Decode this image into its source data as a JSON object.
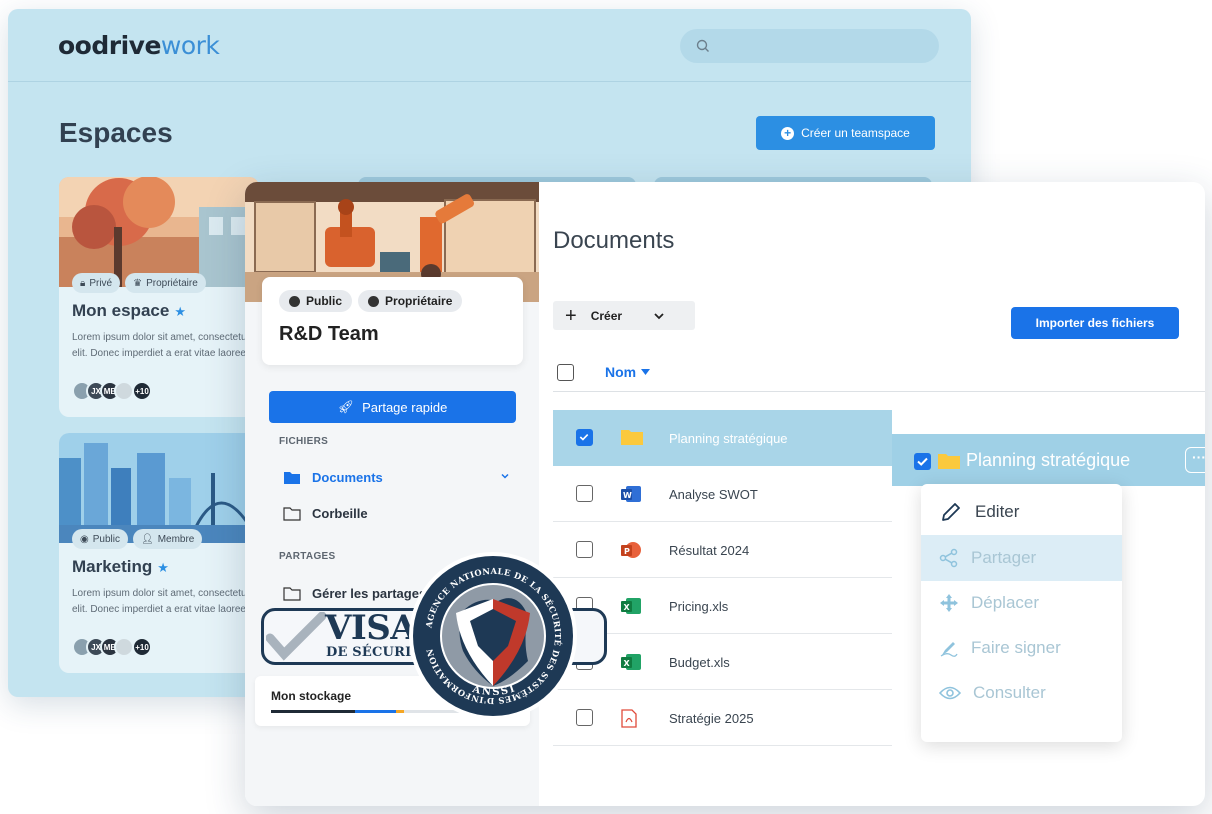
{
  "app": {
    "logo_part1": "oodrive",
    "logo_part2": "work"
  },
  "spaces_page": {
    "title": "Espaces",
    "create_button": "Créer un teamspace",
    "cards": [
      {
        "tags": [
          "Privé",
          "Propriétaire"
        ],
        "name": "Mon espace",
        "desc_line1": "Lorem ipsum dolor sit amet, consectetur",
        "desc_line2": "elit. Donec imperdiet  a erat vitae laoreet",
        "avatars": [
          "",
          "JX",
          "MB",
          "",
          "+10"
        ]
      },
      {
        "tags": [
          "Public",
          "Membre"
        ],
        "name": "Marketing",
        "desc_line1": "Lorem ipsum dolor sit amet, consectetur",
        "desc_line2": "elit. Donec imperdiet  a erat vitae laoreet",
        "avatars": [
          "",
          "JX",
          "MB",
          "",
          "+10"
        ]
      }
    ]
  },
  "team": {
    "tags": [
      "Public",
      "Propriétaire"
    ],
    "name": "R&D Team",
    "quick_share": "Partage rapide",
    "sections": {
      "files": "FICHIERS",
      "shares": "PARTAGES"
    },
    "items": {
      "documents": "Documents",
      "trash": "Corbeille",
      "manage_shares": "Gérer les partages"
    },
    "storage_label": "Mon stockage",
    "storage_segments": [
      {
        "fraction": 0.44,
        "color": "#1f2a36"
      },
      {
        "fraction": 0.22,
        "color": "#1a73e8"
      },
      {
        "fraction": 0.04,
        "color": "#f5a623"
      }
    ]
  },
  "documents": {
    "title": "Documents",
    "create": "Créer",
    "import": "Importer des fichiers",
    "column_name": "Nom",
    "files": [
      {
        "name": "Planning stratégique",
        "type": "folder",
        "selected": true
      },
      {
        "name": "Analyse SWOT",
        "type": "word",
        "selected": false
      },
      {
        "name": "Résultat 2024",
        "type": "powerpoint",
        "selected": false
      },
      {
        "name": "Pricing.xls",
        "type": "excel",
        "selected": false
      },
      {
        "name": "Budget.xls",
        "type": "excel",
        "selected": false
      },
      {
        "name": "Stratégie 2025",
        "type": "pdf",
        "selected": false
      }
    ],
    "dragged_name": "Planning stratégique"
  },
  "context_menu": {
    "items": [
      {
        "label": "Editer",
        "icon": "pencil-icon",
        "highlighted": false
      },
      {
        "label": "Partager",
        "icon": "share-icon",
        "highlighted": true
      },
      {
        "label": "Déplacer",
        "icon": "move-icon",
        "highlighted": false
      },
      {
        "label": "Faire signer",
        "icon": "signature-icon",
        "highlighted": false
      },
      {
        "label": "Consulter",
        "icon": "eye-icon",
        "highlighted": false
      }
    ]
  },
  "badge": {
    "visa": "VISA",
    "visa_sub": "DE SÉCURITÉ",
    "seal_ring": "AGENCE NATIONALE DE LA SÉCURITÉ DES SYSTÈMES D'INFORMATION",
    "seal_bottom": "ANSSI"
  },
  "colors": {
    "accent": "#1a73e8",
    "bg_window": "#c4e4f0",
    "selection": "#a9d5e8"
  }
}
